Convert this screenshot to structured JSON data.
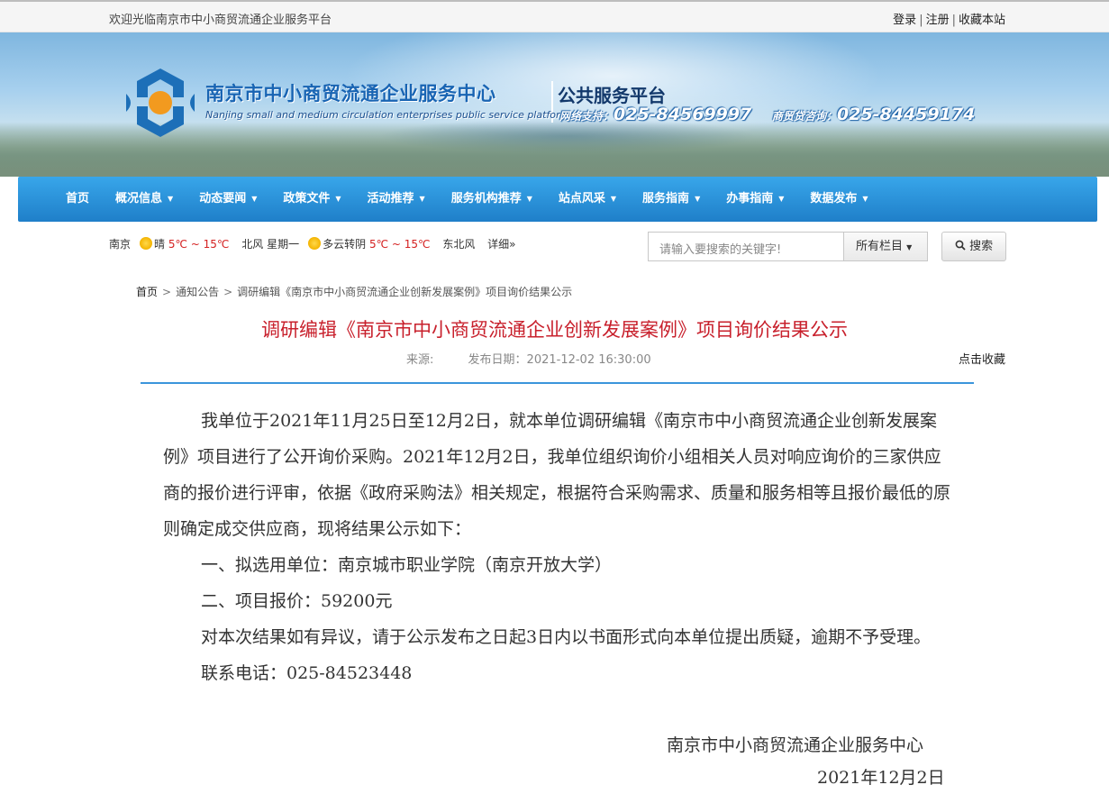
{
  "topbar": {
    "welcome": "欢迎光临南京市中小商贸流通企业服务平台",
    "login": "登录",
    "register": "注册",
    "bookmark": "收藏本站",
    "separator": "|"
  },
  "header": {
    "title_cn": "南京市中小商贸流通企业服务中心",
    "platform": "公共服务平台",
    "title_en": "Nanjing small and medium circulation enterprises public service platform",
    "network_label": "网络支持：",
    "network_phone": "025-84569997",
    "loan_label": "商贸贷咨询：",
    "loan_phone": "025-84459174"
  },
  "nav": {
    "items": [
      {
        "label": "首页"
      },
      {
        "label": "概况信息",
        "caret": "▼"
      },
      {
        "label": "动态要闻",
        "caret": "▼"
      },
      {
        "label": "政策文件",
        "caret": "▼"
      },
      {
        "label": "活动推荐",
        "caret": "▼"
      },
      {
        "label": "服务机构推荐",
        "caret": "▼"
      },
      {
        "label": "站点风采",
        "caret": "▼"
      },
      {
        "label": "服务指南",
        "caret": "▼"
      },
      {
        "label": "办事指南",
        "caret": "▼"
      },
      {
        "label": "数据发布",
        "caret": "▼"
      }
    ]
  },
  "weather": {
    "city": "南京",
    "today_cond": "晴",
    "today_temp": "5℃ ~ 15℃",
    "today_wind": "北风",
    "today_day": "星期一",
    "next_cond": "多云转阴",
    "next_temp": "5℃ ~ 15℃",
    "next_wind": "东北风",
    "details": "详细»"
  },
  "search": {
    "placeholder": "请输入要搜索的关键字!",
    "scope": "所有栏目",
    "button": "搜索"
  },
  "breadcrumb": {
    "home": "首页",
    "section": "通知公告",
    "current": "调研编辑《南京市中小商贸流通企业创新发展案例》项目询价结果公示",
    "sep": ">"
  },
  "article": {
    "title": "调研编辑《南京市中小商贸流通企业创新发展案例》项目询价结果公示",
    "source_label": "来源:",
    "date_label": "发布日期：",
    "date": "2021-12-02 16:30:00",
    "favorite": "点击收藏",
    "paragraphs": [
      "我单位于2021年11月25日至12月2日，就本单位调研编辑《南京市中小商贸流通企业创新发展案例》项目进行了公开询价采购。2021年12月2日，我单位组织询价小组相关人员对响应询价的三家供应商的报价进行评审，依据《政府采购法》相关规定，根据符合采购需求、质量和服务相等且报价最低的原则确定成交供应商，现将结果公示如下：",
      "一、拟选用单位：南京城市职业学院（南京开放大学）",
      "二、项目报价：59200元",
      "对本次结果如有异议，请于公示发布之日起3日内以书面形式向本单位提出质疑，逾期不予受理。",
      "联系电话：025-84523448"
    ],
    "signature_org": "南京市中小商贸流通企业服务中心",
    "signature_date": "2021年12月2日"
  }
}
